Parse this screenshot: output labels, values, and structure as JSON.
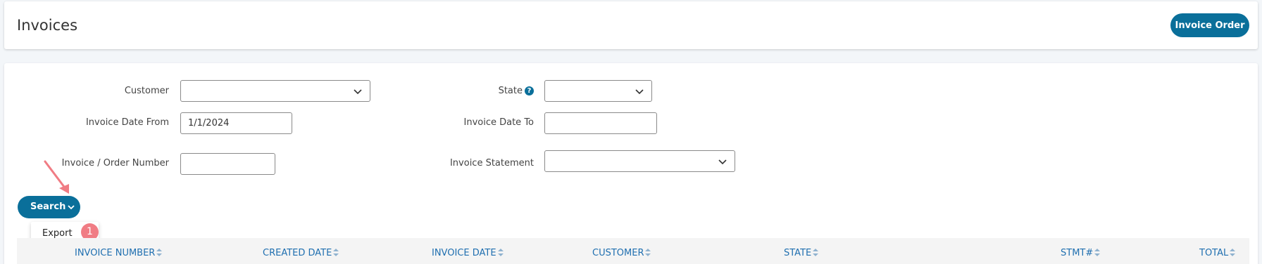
{
  "header": {
    "title": "Invoices",
    "invoice_order_label": "Invoice Order"
  },
  "filters": {
    "customer": {
      "label": "Customer",
      "value": ""
    },
    "state": {
      "label": "State",
      "help_icon": "?",
      "value": ""
    },
    "invoice_date_from": {
      "label": "Invoice Date From",
      "value": "1/1/2024"
    },
    "invoice_date_to": {
      "label": "Invoice Date To",
      "value": ""
    },
    "invoice_order_number": {
      "label": "Invoice / Order Number",
      "value": ""
    },
    "invoice_statement": {
      "label": "Invoice Statement",
      "value": ""
    }
  },
  "search": {
    "label": "Search",
    "menu_items": [
      "Export"
    ]
  },
  "annotations": {
    "step_badge": "1",
    "arrow_color": "#f07c84"
  },
  "table": {
    "columns": [
      "INVOICE NUMBER",
      "CREATED DATE",
      "INVOICE DATE",
      "CUSTOMER",
      "STATE",
      "STMT#",
      "TOTAL"
    ]
  },
  "colors": {
    "primary": "#0a6f9a",
    "header_text": "#1f6fb0"
  }
}
